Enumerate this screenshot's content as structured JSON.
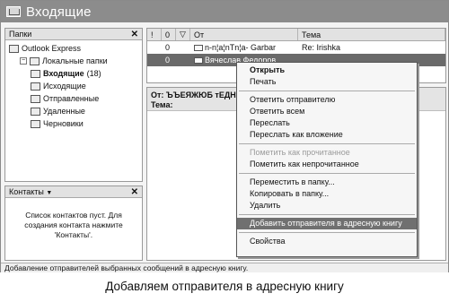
{
  "window": {
    "title": "Входящие"
  },
  "folders": {
    "header": "Папки",
    "close": "✕",
    "items": [
      {
        "label": "Outlook Express",
        "indent": 0
      },
      {
        "label": "Локальные папки",
        "indent": 1,
        "expander": "−"
      },
      {
        "label": "Входящие",
        "count": "(18)",
        "indent": 2
      },
      {
        "label": "Исходящие",
        "indent": 2
      },
      {
        "label": "Отправленные",
        "indent": 2
      },
      {
        "label": "Удаленные",
        "indent": 2
      },
      {
        "label": "Черновики",
        "indent": 2
      }
    ]
  },
  "contacts": {
    "header": "Контакты",
    "header_arrow": "▼",
    "close": "✕",
    "empty_message": "Список контактов пуст. Для создания контакта нажмите 'Контакты'."
  },
  "messages": {
    "columns": {
      "priority": "!",
      "attach": "0",
      "flag": "▽",
      "from": "От",
      "subject": "Тема"
    },
    "rows": [
      {
        "attach": "0",
        "from": "n-n¦a¦nTn¦a- Garbar",
        "subject": "Re: Irishka",
        "selected": false
      },
      {
        "attach": "0",
        "from": "Вячеслав Федоров",
        "subject": "",
        "selected": true
      },
      {
        "attach": "",
        "from": "",
        "subject": "",
        "selected": false
      }
    ]
  },
  "preview": {
    "from_label": "От:",
    "from_value": "ЪЪЕЯЖЮБ тЕДНПН",
    "subject_label": "Тема:"
  },
  "context_menu": {
    "groups": [
      [
        {
          "label": "Открыть",
          "bold": true
        },
        {
          "label": "Печать"
        }
      ],
      [
        {
          "label": "Ответить отправителю"
        },
        {
          "label": "Ответить всем"
        },
        {
          "label": "Переслать"
        },
        {
          "label": "Переслать как вложение"
        }
      ],
      [
        {
          "label": "Пометить как прочитанное",
          "disabled": true
        },
        {
          "label": "Пометить как непрочитанное"
        }
      ],
      [
        {
          "label": "Переместить в папку..."
        },
        {
          "label": "Копировать в папку..."
        },
        {
          "label": "Удалить"
        }
      ],
      [
        {
          "label": "Добавить отправителя в адресную книгу",
          "highlighted": true
        }
      ],
      [
        {
          "label": "Свойства"
        }
      ]
    ]
  },
  "status_bar": {
    "text": "Добавление отправителей выбранных сообщений в адресную книгу."
  },
  "caption": "Добавляем отправителя в адресную книгу"
}
